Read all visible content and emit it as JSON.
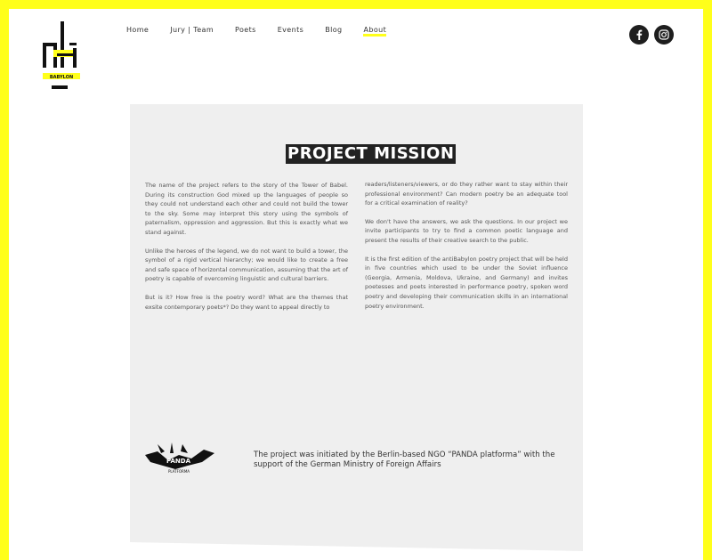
{
  "nav": {
    "items": [
      {
        "label": "Home"
      },
      {
        "label": "Jury | Team"
      },
      {
        "label": "Poets"
      },
      {
        "label": "Events"
      },
      {
        "label": "Blog"
      },
      {
        "label": "About"
      }
    ],
    "active": "About"
  },
  "logo": {
    "subtitle": "BABYLON"
  },
  "social": {
    "icons": [
      "facebook-icon",
      "instagram-icon"
    ]
  },
  "colors": {
    "accent": "#ffff1a",
    "card": "#efefef",
    "dark": "#1e1e1e"
  },
  "mission": {
    "title": "PROJECT MISSION",
    "left_paragraphs": [
      "The name of the project refers to the story of the Tower of Babel. During its construction God mixed up the languages of people so they could not understand each other and could not build the tower to the sky. Some may interpret this story using the symbols of paternalism, oppression and aggression. But this is exactly what we stand against.",
      "Unlike the heroes of the legend, we do not want to build a tower, the symbol of a rigid vertical hierarchy; we would like to create a free and safe space of horizontal communication, assuming that the art of poetry is capable of overcoming linguistic and cultural barriers.",
      "But is it? How free is the poetry word? What are the themes that exsite contemporary poets*? Do they want to appeal directly to"
    ],
    "right_paragraphs": [
      "readers/listeners/viewers, or do they rather want to stay within their professional environment? Can modern poetry be an adequate tool for a critical examination of reality?",
      "We don't have the answers, we ask the questions. In our project we invite participants to try to find a common poetic language and present the results of their creative search to the public.",
      "It is the first edition of the antiBabylon poetry project that will be held in five countries which used to be under the Soviet influence (Georgia, Armenia, Moldova, Ukraine, and Germany) and invites poetesses and poets interested in performance poetry, spoken word poetry and developing their communication skills in an international poetry environment."
    ]
  },
  "panda": {
    "logo_text": "PANDA",
    "logo_sub": "PLATFORMA"
  },
  "initiative_text": "The project was initiated by the Berlin-based NGO “PANDA platforma” with the support of the German Ministry of Foreign Affairs"
}
